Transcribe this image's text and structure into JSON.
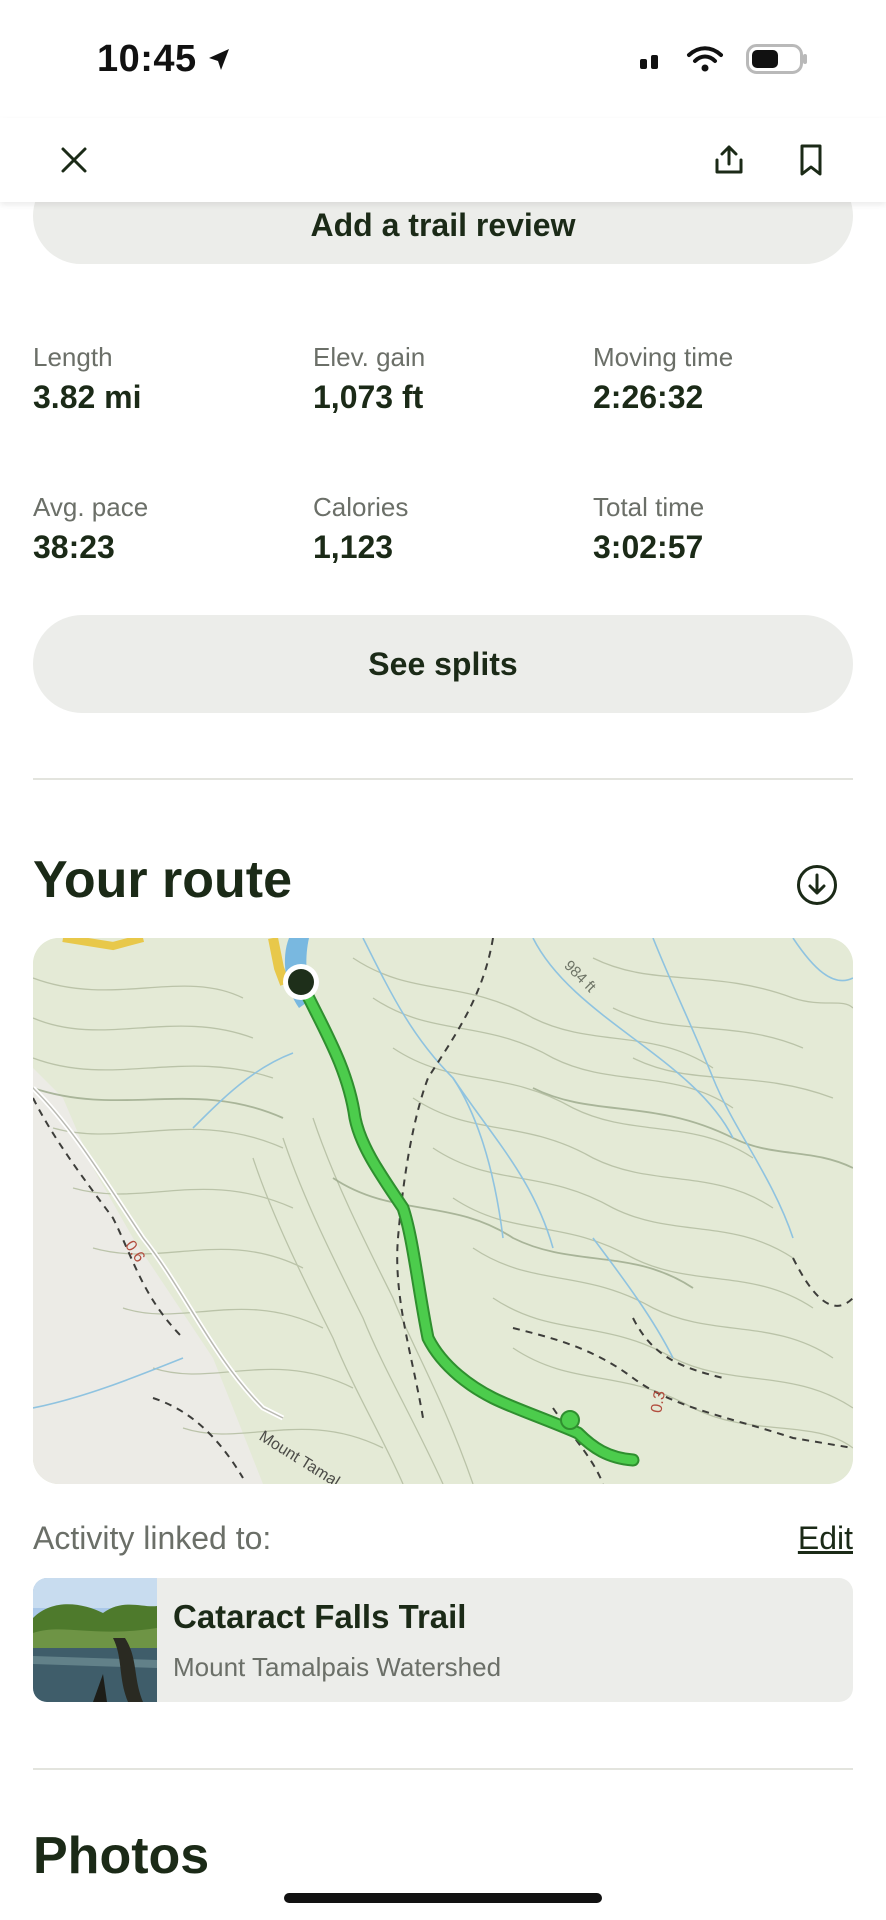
{
  "status": {
    "time": "10:45"
  },
  "topbar": {
    "close_icon": "close-icon",
    "share_icon": "share-icon",
    "bookmark_icon": "bookmark-icon"
  },
  "review": {
    "label": "Add a trail review"
  },
  "stats": [
    {
      "label": "Length",
      "value": "3.82 mi"
    },
    {
      "label": "Elev. gain",
      "value": "1,073 ft"
    },
    {
      "label": "Moving time",
      "value": "2:26:32"
    },
    {
      "label": "Avg. pace",
      "value": "38:23"
    },
    {
      "label": "Calories",
      "value": "1,123"
    },
    {
      "label": "Total time",
      "value": "3:02:57"
    }
  ],
  "splits": {
    "label": "See splits"
  },
  "route": {
    "title": "Your route",
    "download_icon": "download-icon"
  },
  "map": {
    "labels": {
      "elevation": "984 ft",
      "dist1": "0.6",
      "dist2": "0.3",
      "road": "Mount Tamal"
    },
    "colors": {
      "route": "#4ccc4c",
      "water": "#79b8e0",
      "terrain": "#e4ead6"
    }
  },
  "linked": {
    "label": "Activity linked to:",
    "edit": "Edit"
  },
  "trail": {
    "name": "Cataract Falls Trail",
    "area": "Mount Tamalpais Watershed"
  },
  "photos": {
    "title": "Photos"
  }
}
